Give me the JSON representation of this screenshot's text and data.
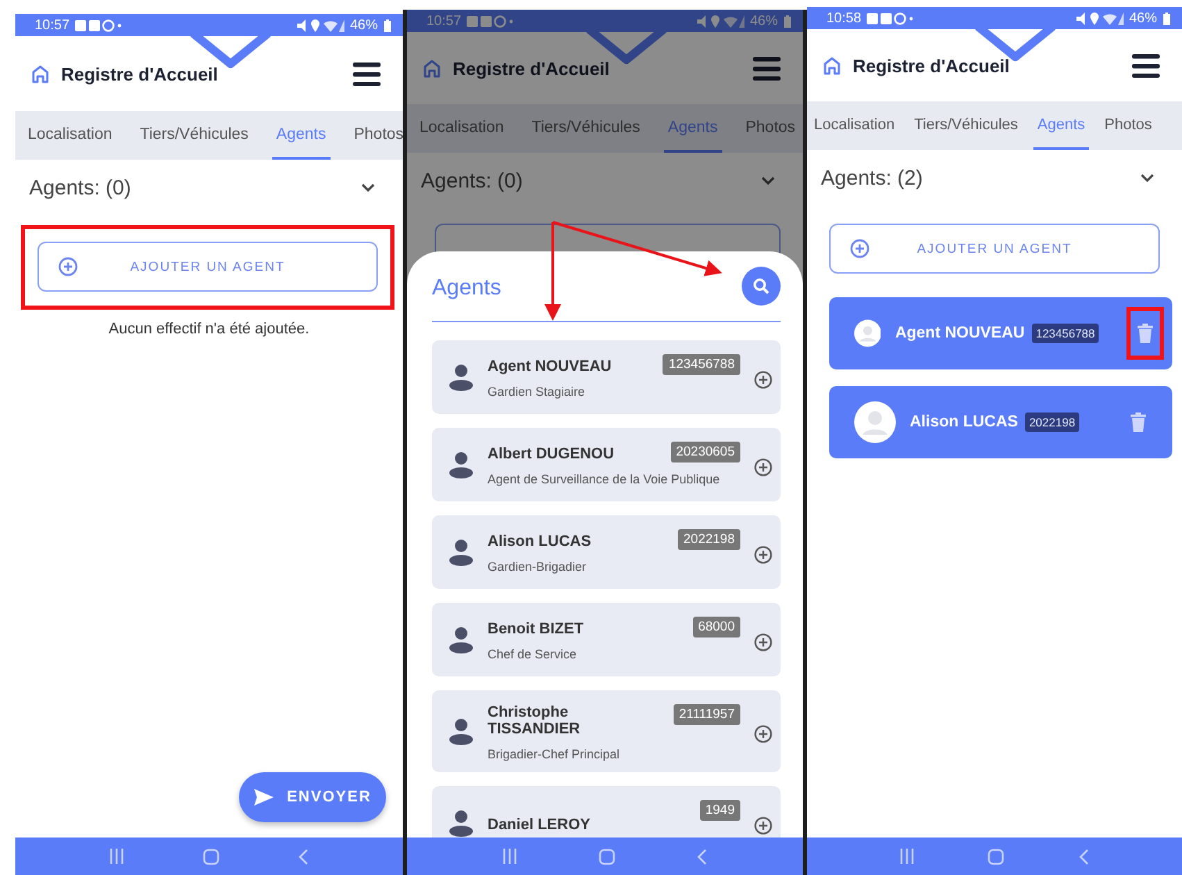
{
  "screens": [
    {
      "kind": "form",
      "status_bar": {
        "time": "10:57",
        "battery": "46%"
      },
      "title": "Registre d'Accueil",
      "tabs": [
        {
          "label": "Localisation",
          "selected": false
        },
        {
          "label": "Tiers/Véhicules",
          "selected": false
        },
        {
          "label": "Agents",
          "selected": true
        },
        {
          "label": "Photos",
          "selected": false
        }
      ],
      "section_title": "Agents: (0)",
      "add_button": {
        "label": "AJOUTER UN AGENT",
        "highlighted": true
      },
      "empty_message": "Aucun effectif n'a été ajoutée.",
      "send_button": "ENVOYER"
    },
    {
      "kind": "picker",
      "status_bar": {
        "time": "10:57",
        "battery": "46%"
      },
      "title": "Registre d'Accueil",
      "tabs": [
        {
          "label": "Localisation",
          "selected": false
        },
        {
          "label": "Tiers/Véhicules",
          "selected": false
        },
        {
          "label": "Agents",
          "selected": true
        },
        {
          "label": "Photos",
          "selected": false
        }
      ],
      "section_title": "Agents: (0)",
      "sheet": {
        "title": "Agents",
        "agents": [
          {
            "name": "Agent NOUVEAU",
            "matricule": "123456788",
            "role": "Gardien Stagiaire"
          },
          {
            "name": "Albert DUGENOU",
            "matricule": "20230605",
            "role": "Agent de Surveillance de la Voie Publique"
          },
          {
            "name": "Alison LUCAS",
            "matricule": "2022198",
            "role": "Gardien-Brigadier"
          },
          {
            "name": "Benoit BIZET",
            "matricule": "68000",
            "role": "Chef de Service"
          },
          {
            "name": "Christophe TISSANDIER",
            "matricule": "21111957",
            "role": "Brigadier-Chef Principal"
          },
          {
            "name": "Daniel LEROY",
            "matricule": "1949"
          }
        ]
      }
    },
    {
      "kind": "form",
      "status_bar": {
        "time": "10:58",
        "battery": "46%"
      },
      "title": "Registre d'Accueil",
      "tabs": [
        {
          "label": "Localisation",
          "selected": false
        },
        {
          "label": "Tiers/Véhicules",
          "selected": false
        },
        {
          "label": "Agents",
          "selected": true
        },
        {
          "label": "Photos",
          "selected": false
        }
      ],
      "section_title": "Agents: (2)",
      "add_button": {
        "label": "AJOUTER UN AGENT",
        "highlighted": false
      },
      "agents": [
        {
          "name": "Agent NOUVEAU",
          "matricule": "123456788",
          "delete_highlighted": true
        },
        {
          "name": "Alison LUCAS",
          "matricule": "2022198",
          "delete_highlighted": false
        }
      ]
    }
  ]
}
